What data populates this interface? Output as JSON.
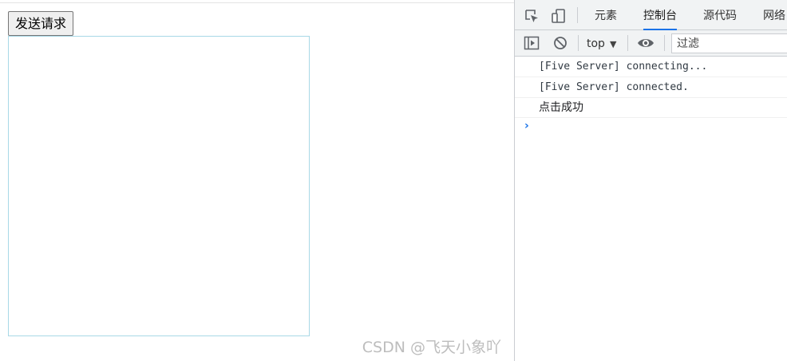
{
  "page": {
    "send_button_label": "发送请求",
    "watermark": "CSDN @飞天小象吖"
  },
  "devtools": {
    "tabs": [
      {
        "label": "元素",
        "active": false
      },
      {
        "label": "控制台",
        "active": true
      },
      {
        "label": "源代码",
        "active": false
      },
      {
        "label": "网络",
        "active": false
      }
    ],
    "toolbar": {
      "context": "top",
      "filter_placeholder": "过滤"
    },
    "console": {
      "messages": [
        {
          "text": "[Five Server] connecting..."
        },
        {
          "text": "[Five Server] connected."
        },
        {
          "text": "点击成功"
        }
      ],
      "prompt_symbol": "›"
    },
    "colors": {
      "accent": "#1a73e8",
      "toolbar_bg": "#f1f3f4",
      "border": "#cacdd1"
    }
  }
}
